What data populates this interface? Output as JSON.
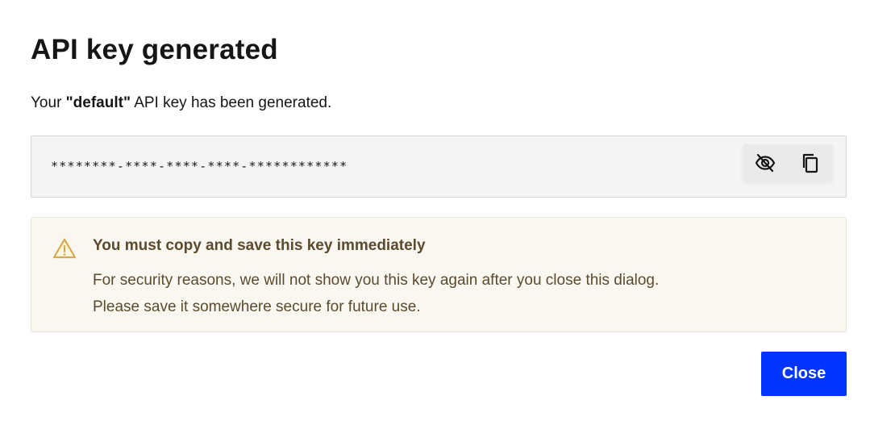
{
  "dialog": {
    "title": "API key generated",
    "desc_prefix": "Your ",
    "desc_bold": "\"default\"",
    "desc_suffix": " API key has been generated."
  },
  "key": {
    "masked_value": "********-****-****-****-************",
    "toggle_visibility_icon": "eye-slash-icon",
    "copy_icon": "copy-icon"
  },
  "warning": {
    "icon": "warning-triangle-icon",
    "title": "You must copy and save this key immediately",
    "line1": "For security reasons, we will not show you this key again after you close this dialog.",
    "line2": "Please save it somewhere secure for future use.",
    "accent_color": "#d6a94a"
  },
  "actions": {
    "close_label": "Close",
    "close_color": "#0035ff"
  }
}
